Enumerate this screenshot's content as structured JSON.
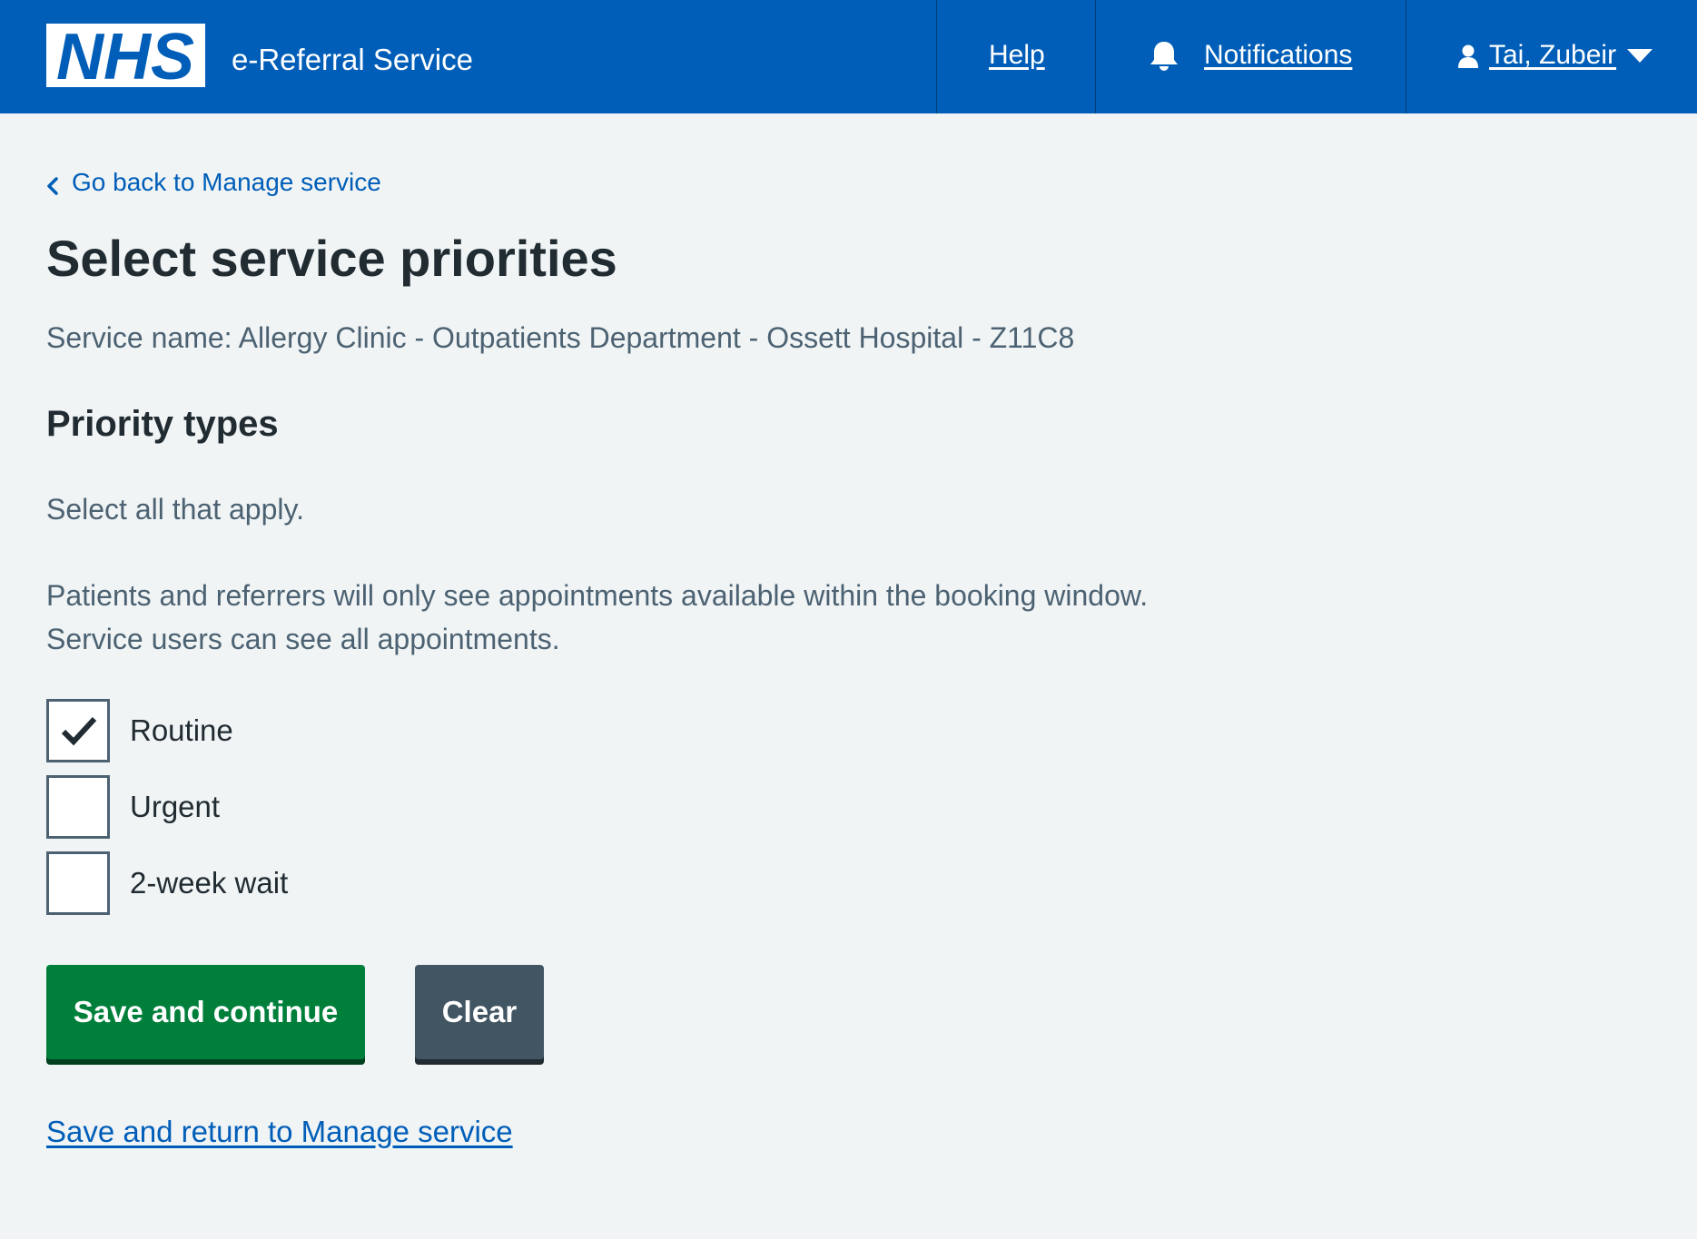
{
  "header": {
    "logo_text": "NHS",
    "service_name": "e-Referral Service",
    "nav": {
      "help": "Help",
      "notifications": "Notifications",
      "user": "Tai, Zubeir"
    },
    "colors": {
      "background": "#005eb8",
      "text": "#ffffff"
    },
    "icons": [
      "bell-icon",
      "person-icon",
      "caret-down-icon"
    ]
  },
  "back_link": {
    "text": "Go back to Manage service",
    "icon": "chevron-left-icon"
  },
  "page_title": "Select service priorities",
  "service_line": "Service name: Allergy Clinic - Outpatients Department - Ossett Hospital - Z11C8",
  "priority_types": {
    "heading": "Priority types",
    "hint_select": "Select all that apply.",
    "hint_booking": "Patients and referrers will only see appointments available within the booking window. Service users can see all appointments.",
    "options": [
      {
        "label": "Routine",
        "checked": true
      },
      {
        "label": "Urgent",
        "checked": false
      },
      {
        "label": "2-week wait",
        "checked": false
      }
    ]
  },
  "actions": {
    "save_continue": "Save and continue",
    "clear": "Clear",
    "save_return": "Save and return to Manage service"
  },
  "colors": {
    "page_background": "#f0f4f5",
    "link": "#005eb8",
    "primary_button": "#007f3b",
    "secondary_button": "#425563",
    "secondary_text": "#4c6272"
  }
}
